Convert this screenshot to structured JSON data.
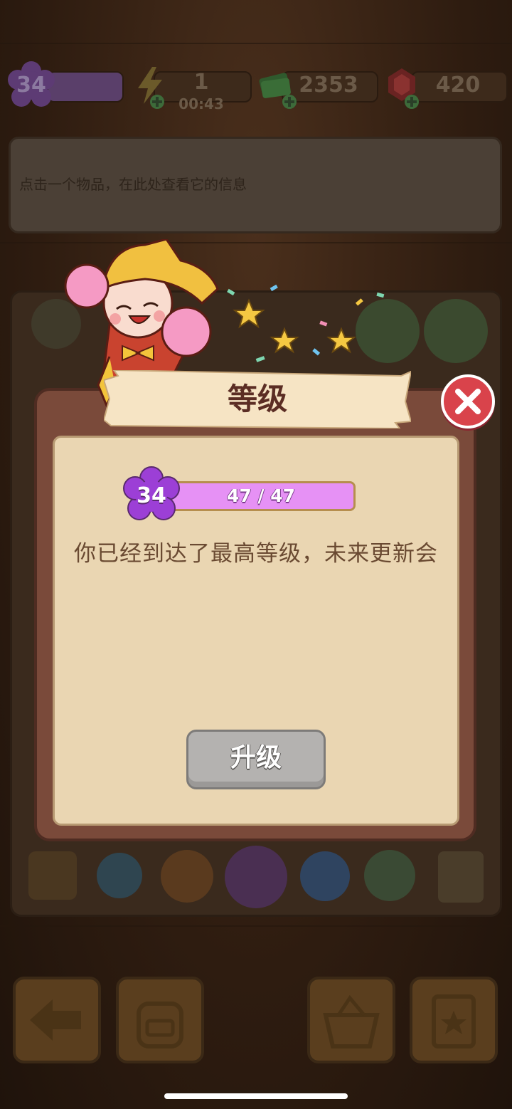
{
  "hud": {
    "level": "34",
    "energy": {
      "value": "1",
      "timer": "00:43"
    },
    "cash": "2353",
    "gems": "420"
  },
  "info_panel": {
    "hint": "点击一个物品，在此处查看它的信息"
  },
  "modal": {
    "title": "等级",
    "level": "34",
    "xp_text": "47 / 47",
    "xp_fraction": 1.0,
    "message": "你已经到达了最高等级，未来更新会",
    "upgrade_label": "升级"
  },
  "colors": {
    "xp_fill": "#e691f5",
    "level_badge": "#9c3fd6",
    "close_button": "#d9434b",
    "upgrade_button": "#b4b2b0"
  }
}
